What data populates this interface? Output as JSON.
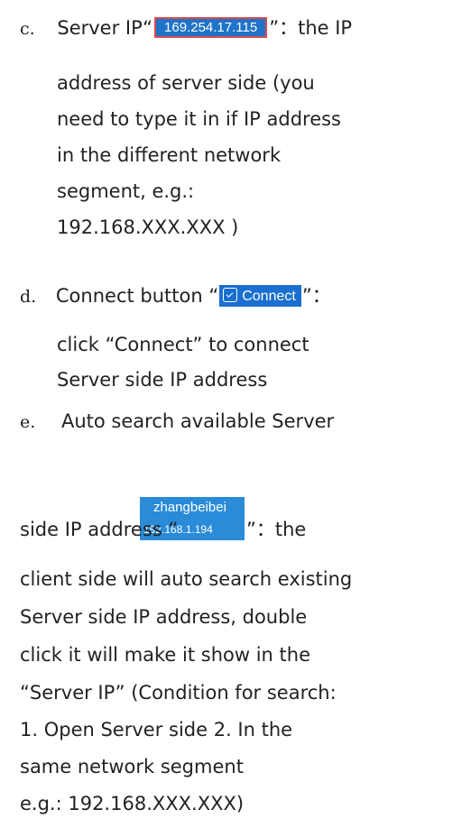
{
  "items": {
    "c": {
      "marker": "c.",
      "label_before": "Server IP“",
      "ip_value": "169.254.17.115",
      "label_after": "”：the IP",
      "lines": [
        "address of server side (you",
        "need to type it in if IP address",
        "in the different network",
        "segment, e.g.:",
        "192.168.XXX.XXX )"
      ]
    },
    "d": {
      "marker": "d.",
      "label_before": "Connect button “",
      "button_label": "Connect",
      "label_after": "”：",
      "lines": [
        "click “Connect” to connect",
        "Server side IP address"
      ]
    },
    "e": {
      "marker": "e.",
      "first_line": "Auto search available Server",
      "label_before": "side IP address “",
      "server_name": "zhangbeibei",
      "server_ip": "192.168.1.194",
      "label_after": "”：the",
      "lines": [
        "client side will auto search existing",
        "Server side IP address, double",
        "click it will make it show in the",
        "“Server IP” (Condition for search:",
        "1.  Open Server side 2.  In the",
        "same network segment",
        "e.g.: 192.168.XXX.XXX)"
      ]
    }
  },
  "colors": {
    "ip_chip_bg": "#1f73c9",
    "ip_chip_border": "#d84a4a",
    "connect_bg": "#1a6fd0",
    "server_chip_bg": "#2a8bd8"
  },
  "icons": {
    "connect": "connect-check-icon"
  }
}
